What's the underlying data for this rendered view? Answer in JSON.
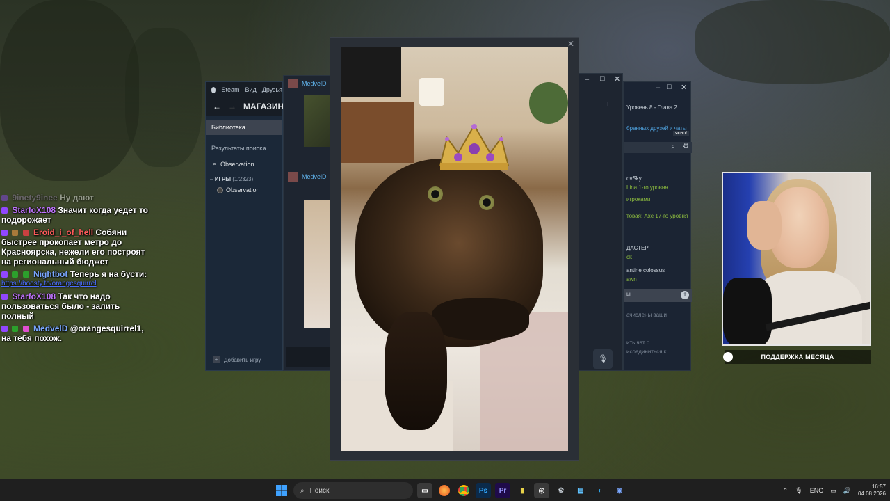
{
  "steam": {
    "menu": [
      "Steam",
      "Вид",
      "Друзья"
    ],
    "store_title": "МАГАЗИН",
    "library_label": "Библиотека",
    "search_results_label": "Результаты поиска",
    "search_value": "Observation",
    "category_label": "ИГРЫ",
    "category_count": "(1/2323)",
    "game_item": "Observation",
    "add_game_label": "Добавить игру"
  },
  "chat_window": {
    "user_1": "MedvelD",
    "user_2": "MedvelD"
  },
  "friends_window": {
    "lines": [
      "Уровень 8 - Глава 2",
      "бранных друзей и чаты",
      "ясно!",
      "ovSky",
      "Lina 1-го уровня",
      "игроками",
      "товая: Axe 17-го уровня",
      "ДАСТЕР",
      "ck",
      "antine colossus",
      "awn",
      "ы",
      "ачислены ваши",
      "ить чат с",
      "исоединиться к"
    ]
  },
  "stream_chat": [
    {
      "user": "9inety9inee",
      "text": "Ну дают",
      "color": "#9a86b0",
      "faded": true
    },
    {
      "user": "StarfoX108",
      "text": "Значит когда уедет то подорожает",
      "color": "#c074ff"
    },
    {
      "user": "Eroid_i_of_hell",
      "text": "Собяни быстрее прокопает метро до Красноярска, нежели его построят на региональный бюджет",
      "color": "#ff5b5b"
    },
    {
      "user": "Nightbot",
      "text": "Теперь я на бусти:",
      "link": "https://boosty.to/orangesquirrel",
      "color": "#7aa7ff"
    },
    {
      "user": "StarfoX108",
      "text": "Так что надо пользоваться было - залить полный",
      "color": "#c074ff"
    },
    {
      "user": "MedvelD",
      "text": "@orangesquirrel1, на тебя похож.",
      "color": "#7aa7ff"
    }
  ],
  "support_banner": "ПОДДЕРЖКА МЕСЯЦА",
  "taskbar": {
    "search_placeholder": "Поиск",
    "lang": "ENG",
    "time": "16:57",
    "date": "04.08.2026"
  }
}
